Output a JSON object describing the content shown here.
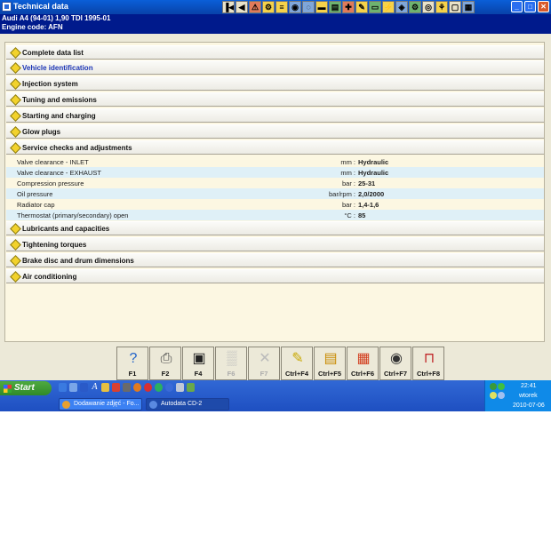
{
  "window": {
    "title": "Technical data"
  },
  "toolbar": {
    "buttons": [
      {
        "icon": "first-page-icon",
        "glyph": "▐◀",
        "tone": ""
      },
      {
        "icon": "previous-icon",
        "glyph": "◀",
        "tone": ""
      },
      {
        "icon": "warning-icon",
        "glyph": "⚠",
        "tone": "r"
      },
      {
        "icon": "engine-icon",
        "glyph": "⚙",
        "tone": "y"
      },
      {
        "icon": "schematic-icon",
        "glyph": "≡",
        "tone": "y"
      },
      {
        "icon": "timing-icon",
        "glyph": "◉",
        "tone": "b"
      },
      {
        "icon": "filter-icon",
        "glyph": "◌",
        "tone": "b"
      },
      {
        "icon": "car-lift-icon",
        "glyph": "▬",
        "tone": "y"
      },
      {
        "icon": "manual-icon",
        "glyph": "▤",
        "tone": "g"
      },
      {
        "icon": "repair-icon",
        "glyph": "✚",
        "tone": "r"
      },
      {
        "icon": "tools-icon",
        "glyph": "✎",
        "tone": "y"
      },
      {
        "icon": "battery-icon",
        "glyph": "▭",
        "tone": "g"
      },
      {
        "icon": "electrics-icon",
        "glyph": "⚡",
        "tone": "y"
      },
      {
        "icon": "diagnostics-icon",
        "glyph": "◈",
        "tone": "b"
      },
      {
        "icon": "settings-icon",
        "glyph": "⚙",
        "tone": "g"
      },
      {
        "icon": "brake-icon",
        "glyph": "◎",
        "tone": ""
      },
      {
        "icon": "wiring-icon",
        "glyph": "⚘",
        "tone": "y"
      },
      {
        "icon": "document-icon",
        "glyph": "▢",
        "tone": ""
      },
      {
        "icon": "print-icon",
        "glyph": "▦",
        "tone": "b"
      }
    ]
  },
  "vehicle": {
    "model": "Audi   A4 (94-01) 1,90 TDI 1995-01",
    "engine_code": "Engine code: AFN"
  },
  "sections": [
    {
      "label": "Complete data list",
      "link": false
    },
    {
      "label": "Vehicle identification",
      "link": true
    },
    {
      "label": "Injection system",
      "link": false
    },
    {
      "label": "Tuning and emissions",
      "link": false
    },
    {
      "label": "Starting and charging",
      "link": false
    },
    {
      "label": "Glow plugs",
      "link": false
    },
    {
      "label": "Service checks and adjustments",
      "link": false
    },
    {
      "label": "Lubricants and capacities",
      "link": false
    },
    {
      "label": "Tightening torques",
      "link": false
    },
    {
      "label": "Brake disc and drum dimensions",
      "link": false
    },
    {
      "label": "Air conditioning",
      "link": false
    }
  ],
  "service_rows": [
    {
      "name": "Valve clearance - INLET",
      "unit": "mm :",
      "value": "Hydraulic"
    },
    {
      "name": "Valve clearance - EXHAUST",
      "unit": "mm :",
      "value": "Hydraulic"
    },
    {
      "name": "Compression pressure",
      "unit": "bar :",
      "value": "25-31"
    },
    {
      "name": "Oil pressure",
      "unit": "bar/rpm :",
      "value": "2,0/2000"
    },
    {
      "name": "Radiator cap",
      "unit": "bar :",
      "value": "1,4-1,6"
    },
    {
      "name": "Thermostat (primary/secondary) open",
      "unit": "°C :",
      "value": "85"
    }
  ],
  "function_keys": [
    {
      "key": "F1",
      "icon": "help-icon",
      "glyph": "?",
      "enabled": true,
      "color": "#1f62c9"
    },
    {
      "key": "F2",
      "icon": "printer-icon",
      "glyph": "⎙",
      "enabled": true,
      "color": "#444444"
    },
    {
      "key": "F4",
      "icon": "display-icon",
      "glyph": "▣",
      "enabled": true,
      "color": "#222222"
    },
    {
      "key": "F6",
      "icon": "object-icon",
      "glyph": "▒",
      "enabled": false,
      "color": "#bbbbbb"
    },
    {
      "key": "F7",
      "icon": "tools-icon",
      "glyph": "✕",
      "enabled": false,
      "color": "#bbbbbb"
    },
    {
      "key": "Ctrl+F4",
      "icon": "notepad-icon",
      "glyph": "✎",
      "enabled": true,
      "color": "#c8a800"
    },
    {
      "key": "Ctrl+F5",
      "icon": "clipboard-icon",
      "glyph": "▤",
      "enabled": true,
      "color": "#c88a00"
    },
    {
      "key": "Ctrl+F6",
      "icon": "calculator-icon",
      "glyph": "▦",
      "enabled": true,
      "color": "#d23c1c"
    },
    {
      "key": "Ctrl+F7",
      "icon": "tyre-icon",
      "glyph": "◉",
      "enabled": true,
      "color": "#333333"
    },
    {
      "key": "Ctrl+F8",
      "icon": "car-lift-icon",
      "glyph": "⊓",
      "enabled": true,
      "color": "#c0282a"
    }
  ],
  "taskbar": {
    "start_label": "Start",
    "tasks": [
      {
        "label": "Dodawanie zdjęć - Fo...",
        "icon": "browser-icon",
        "color": "#e8a030",
        "active": false
      },
      {
        "label": "Autodata CD-2",
        "icon": "app-icon",
        "color": "#5a8ae0",
        "active": true
      }
    ],
    "clock": {
      "time": "22:41",
      "day": "wtorek",
      "date": "2010-07-06"
    }
  }
}
